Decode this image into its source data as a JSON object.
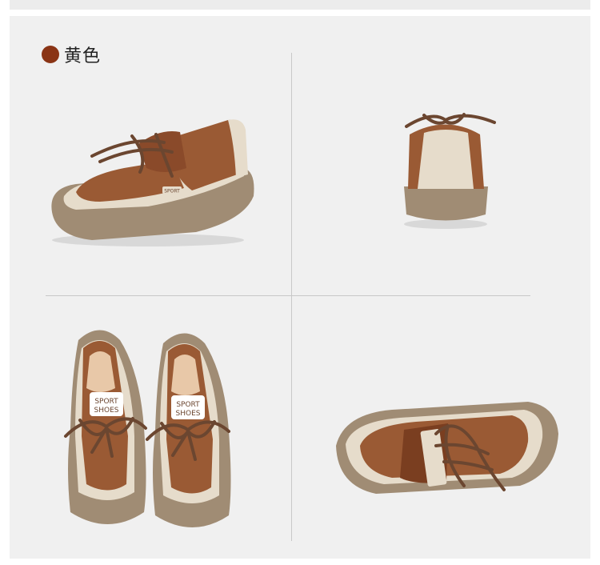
{
  "color_option": {
    "label": "黄色",
    "swatch_color": "#8a3415"
  },
  "palette": {
    "suede": "#9a5a34",
    "cream": "#e6dccb",
    "sole": "#a08c74",
    "lace": "#6b4630"
  },
  "views": [
    "side-view",
    "back-view",
    "top-view-pair",
    "rear-angled-view"
  ],
  "tongue_text": {
    "line1": "SPORT",
    "line2": "SHOES",
    "side_tag": "SPORT"
  }
}
